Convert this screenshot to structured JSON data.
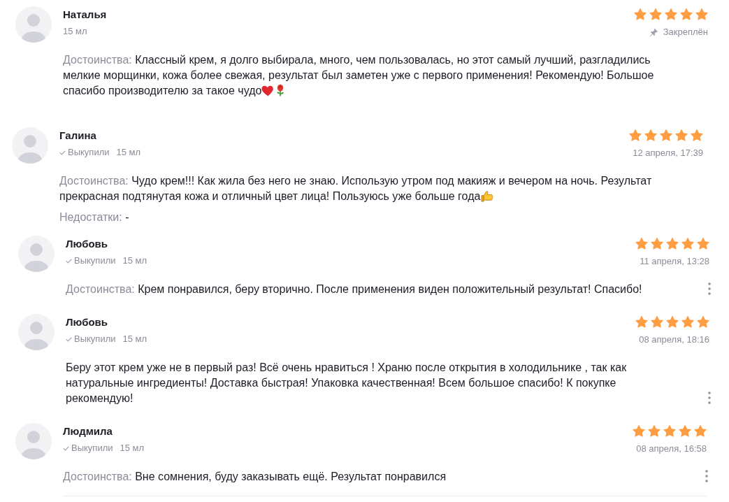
{
  "reviews": [
    {
      "author": "Наталья",
      "variant": "15 мл",
      "stars": 5,
      "pin_label": "Закреплён",
      "menu": false,
      "sections": [
        {
          "label": "Достоинства:",
          "text": "Классный крем, я долго выбирала, много, чем пользовалась, но этот самый лучший, разгладились мелкие морщинки, кожа более свежая, результат был заметен уже с первого применения! Рекомендую! Большое спасибо производителю за такое чудо",
          "emoji": [
            {
              "kind": "heart"
            },
            {
              "kind": "rose"
            }
          ]
        }
      ]
    },
    {
      "author": "Галина",
      "purchase_label": "Выкупили",
      "variant": "15 мл",
      "stars": 5,
      "date": "12 апреля, 17:39",
      "menu": false,
      "sections": [
        {
          "label": "Достоинства:",
          "text": "Чудо крем!!! Как жила без него не знаю. Использую утром под макияж и вечером на ночь. Результат прекрасная подтянутая кожа и отличный цвет лица! Пользуюсь уже больше года",
          "emoji": [
            {
              "kind": "thumbs_up"
            }
          ]
        },
        {
          "label": "Недостатки:",
          "text": "-"
        }
      ]
    },
    {
      "author": "Любовь",
      "purchase_label": "Выкупили",
      "variant": "15 мл",
      "stars": 5,
      "date": "11 апреля, 13:28",
      "menu": true,
      "sections": [
        {
          "label": "Достоинства:",
          "text": "Крем понравился, беру вторично. После применения виден положительный результат! Спасибо!"
        }
      ]
    },
    {
      "author": "Любовь",
      "purchase_label": "Выкупили",
      "variant": "15 мл",
      "stars": 5,
      "date": "08 апреля, 18:16",
      "menu": true,
      "sections": [
        {
          "text": "Беру этот крем уже не в первый раз! Всё очень нравиться ! Храню после открытия в холодильнике , так как натуральные ингредиенты! Доставка быстрая! Упаковка качественная! Всем большое спасибо! К покупке рекомендую!"
        }
      ]
    },
    {
      "author": "Людмила",
      "purchase_label": "Выкупили",
      "variant": "15 мл",
      "stars": 5,
      "date": "08 апреля, 16:58",
      "menu": true,
      "sections": [
        {
          "label": "Достоинства:",
          "text": "Вне сомнения, буду заказывать ещё. Результат понравился"
        }
      ]
    }
  ]
}
